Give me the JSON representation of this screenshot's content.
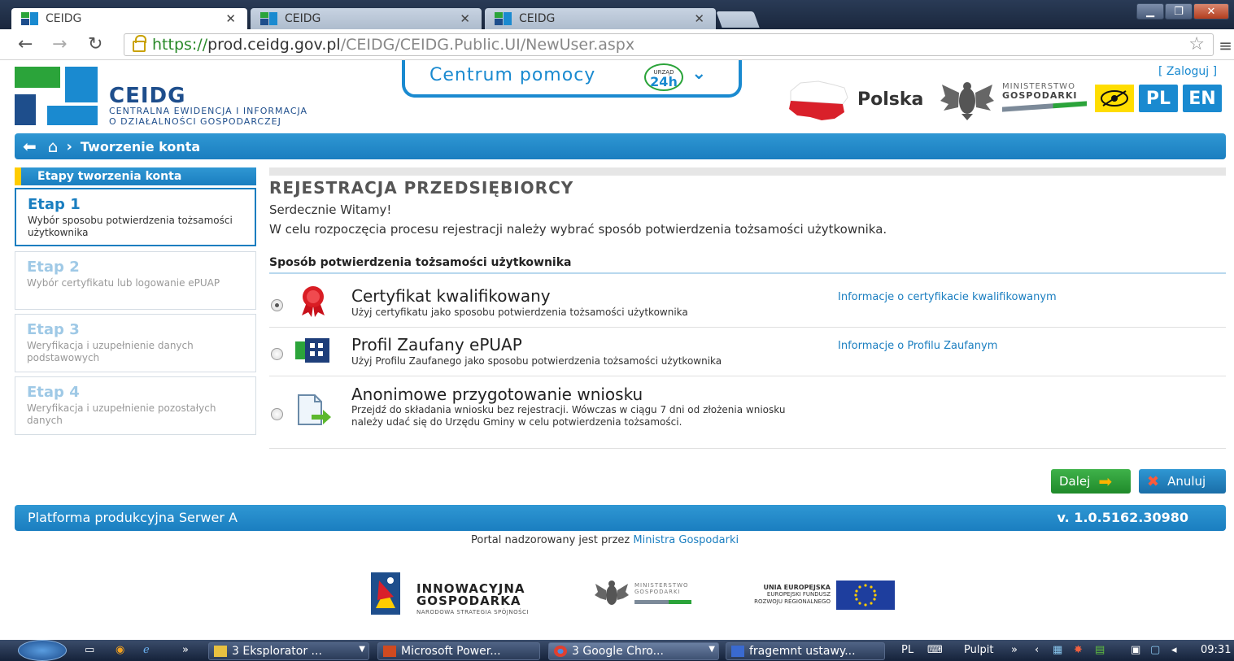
{
  "browser": {
    "tabs": [
      {
        "label": "CEIDG",
        "active": true
      },
      {
        "label": "CEIDG",
        "active": false
      },
      {
        "label": "CEIDG",
        "active": false
      }
    ],
    "url_secure": "https://",
    "url_host": "prod.ceidg.gov.pl",
    "url_path": "/CEIDG/CEIDG.Public.UI/NewUser.aspx"
  },
  "header": {
    "title": "CEIDG",
    "subtitle_line1": "CENTRALNA EWIDENCJA I INFORMACJA",
    "subtitle_line2": "O DZIAŁALNOŚCI GOSPODARCZEJ",
    "help_label": "Centrum pomocy",
    "urzad_top": "URZĄD",
    "urzad_24h": "24h",
    "login_label": "[ Zaloguj ]",
    "polska": "Polska",
    "ministry_line1": "MINISTERSTWO",
    "ministry_line2": "GOSPODARKI",
    "lang_pl": "PL",
    "lang_en": "EN"
  },
  "breadcrumb": {
    "current": "Tworzenie konta"
  },
  "sidebar": {
    "heading": "Etapy tworzenia konta",
    "steps": [
      {
        "title": "Etap 1",
        "desc": "Wybór sposobu potwierdzenia tożsamości użytkownika",
        "active": true
      },
      {
        "title": "Etap 2",
        "desc": "Wybór certyfikatu lub logowanie ePUAP",
        "active": false
      },
      {
        "title": "Etap 3",
        "desc": "Weryfikacja i uzupełnienie danych podstawowych",
        "active": false
      },
      {
        "title": "Etap 4",
        "desc": "Weryfikacja i uzupełnienie pozostałych danych",
        "active": false
      }
    ]
  },
  "main": {
    "title": "REJESTRACJA PRZEDSIĘBIORCY",
    "welcome": "Serdecznie Witamy!",
    "intro": "W celu rozpoczęcia procesu rejestracji należy wybrać sposób potwierdzenia tożsamości użytkownika.",
    "section_title": "Sposób potwierdzenia tożsamości użytkownika",
    "options": [
      {
        "title": "Certyfikat kwalifikowany",
        "desc": "Użyj certyfikatu jako sposobu potwierdzenia tożsamości użytkownika",
        "link": "Informacje o certyfikacie kwalifikowanym",
        "selected": true
      },
      {
        "title": "Profil Zaufany ePUAP",
        "desc": "Użyj Profilu Zaufanego jako sposobu potwierdzenia tożsamości użytkownika",
        "link": "Informacje o Profilu Zaufanym",
        "selected": false
      },
      {
        "title": "Anonimowe przygotowanie wniosku",
        "desc": "Przejdź do składania wniosku bez rejestracji. Wówczas w ciągu 7 dni od złożenia wniosku należy udać się do Urzędu Gminy w celu potwierdzenia tożsamości.",
        "link": "",
        "selected": false
      }
    ],
    "next_label": "Dalej",
    "cancel_label": "Anuluj"
  },
  "footer": {
    "platform": "Platforma produkcyjna Serwer A",
    "version": "v. 1.0.5162.30980",
    "portal_text": "Portal nadzorowany jest przez",
    "portal_link": "Ministra Gospodarki",
    "ig_line1": "INNOWACYJNA",
    "ig_line2": "GOSPODARKA",
    "ig_line3": "NARODOWA STRATEGIA SPÓJNOŚCI",
    "mg_line1": "MINISTERSTWO",
    "mg_line2": "GOSPODARKI",
    "ue_line1": "UNIA EUROPEJSKA",
    "ue_line2": "EUROPEJSKI FUNDUSZ",
    "ue_line3": "ROZWOJU REGIONALNEGO"
  },
  "taskbar": {
    "items": [
      "3 Eksplorator ...",
      "Microsoft Power...",
      "3 Google Chro...",
      "fragemnt ustawy..."
    ],
    "lang": "PL",
    "desktop": "Pulpit",
    "time": "09:31"
  },
  "colors": {
    "accent": "#1a7ec0",
    "green": "#2ba43a",
    "yellow": "#ffcc00"
  }
}
